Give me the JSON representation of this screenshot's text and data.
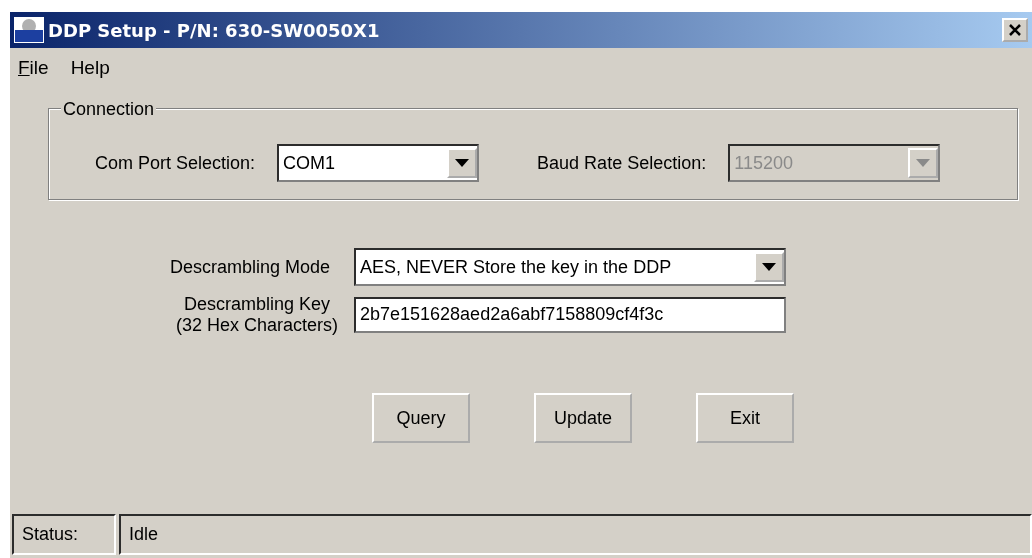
{
  "window": {
    "title": "DDP Setup - P/N: 630-SW0050X1"
  },
  "menu": [
    {
      "label": "File",
      "mnemonic": true
    },
    {
      "label": "Help",
      "mnemonic": false
    }
  ],
  "connection": {
    "title": "Connection",
    "fields": [
      {
        "label": "Com Port Selection:",
        "value": "COM1",
        "disabled": false
      },
      {
        "label": "Baud Rate Selection:",
        "value": "115200",
        "disabled": true
      }
    ]
  },
  "descrambling_mode": {
    "label": "Descrambling Mode",
    "value": "AES, NEVER Store the key in the DDP"
  },
  "descrambling_key": {
    "label_lines": [
      "Descrambling Key",
      "(32 Hex Characters)"
    ],
    "value": "2b7e151628aed2a6abf7158809cf4f3c"
  },
  "buttons": [
    "Query",
    "Update",
    "Exit"
  ],
  "status_bar": {
    "label": "Status:",
    "value": "Idle"
  }
}
